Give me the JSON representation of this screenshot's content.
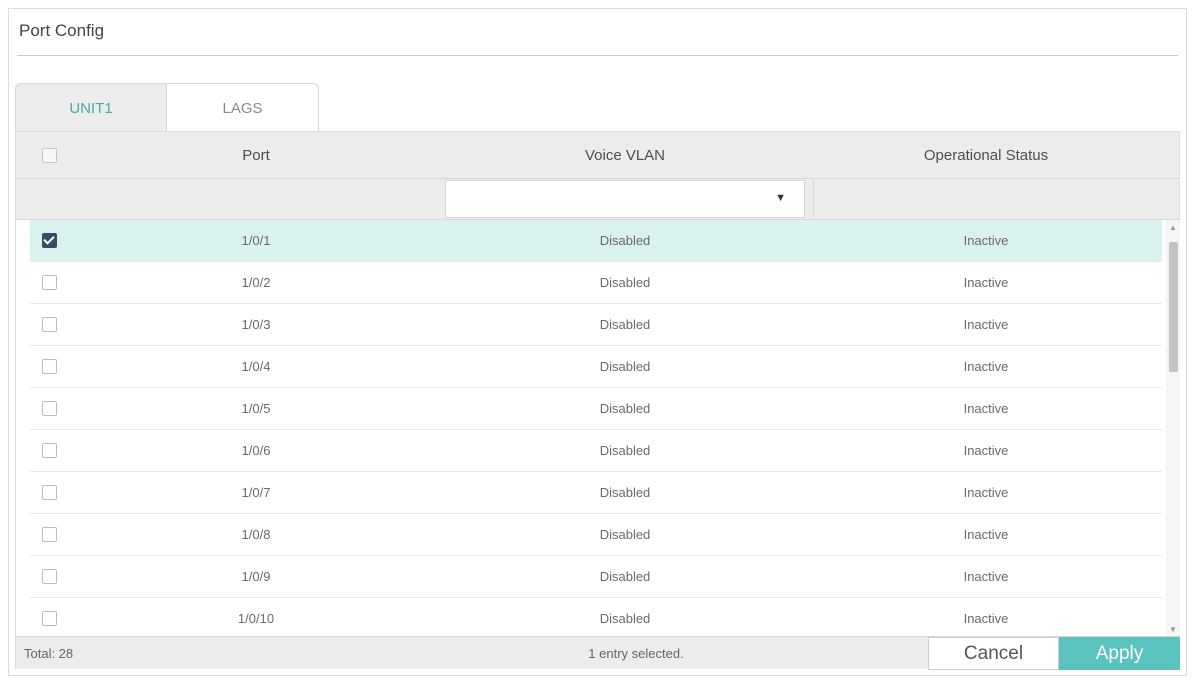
{
  "panel": {
    "title": "Port Config"
  },
  "tabs": [
    {
      "label": "UNIT1",
      "active": true
    },
    {
      "label": "LAGS",
      "active": false
    }
  ],
  "table": {
    "headers": {
      "port": "Port",
      "voice_vlan": "Voice VLAN",
      "status": "Operational Status"
    },
    "filter": {
      "voice_vlan": ""
    },
    "rows": [
      {
        "checked": true,
        "port": "1/0/1",
        "voice_vlan": "Disabled",
        "status": "Inactive"
      },
      {
        "checked": false,
        "port": "1/0/2",
        "voice_vlan": "Disabled",
        "status": "Inactive"
      },
      {
        "checked": false,
        "port": "1/0/3",
        "voice_vlan": "Disabled",
        "status": "Inactive"
      },
      {
        "checked": false,
        "port": "1/0/4",
        "voice_vlan": "Disabled",
        "status": "Inactive"
      },
      {
        "checked": false,
        "port": "1/0/5",
        "voice_vlan": "Disabled",
        "status": "Inactive"
      },
      {
        "checked": false,
        "port": "1/0/6",
        "voice_vlan": "Disabled",
        "status": "Inactive"
      },
      {
        "checked": false,
        "port": "1/0/7",
        "voice_vlan": "Disabled",
        "status": "Inactive"
      },
      {
        "checked": false,
        "port": "1/0/8",
        "voice_vlan": "Disabled",
        "status": "Inactive"
      },
      {
        "checked": false,
        "port": "1/0/9",
        "voice_vlan": "Disabled",
        "status": "Inactive"
      },
      {
        "checked": false,
        "port": "1/0/10",
        "voice_vlan": "Disabled",
        "status": "Inactive"
      }
    ]
  },
  "footer": {
    "total": "Total: 28",
    "selected": "1 entry selected.",
    "cancel_label": "Cancel",
    "apply_label": "Apply"
  },
  "icons": {
    "select_caret": "▼",
    "scroll_up": "▲",
    "scroll_down": "▼"
  },
  "colors": {
    "accent": "#5bc3be",
    "tab_active_text": "#4aa9a5",
    "selected_row": "#d9f2ef",
    "checkbox_checked": "#3a4c66"
  }
}
